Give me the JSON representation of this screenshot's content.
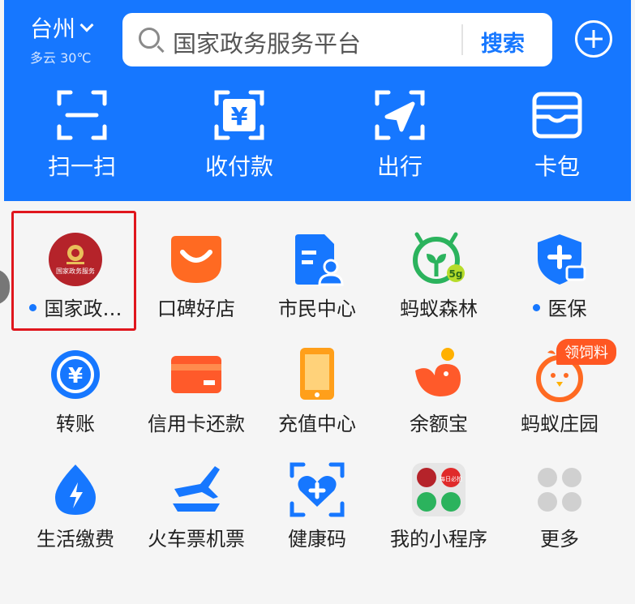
{
  "header": {
    "city": "台州",
    "weather": "多云 30℃",
    "search_placeholder": "国家政务服务平台",
    "search_button": "搜索"
  },
  "quick_actions": [
    {
      "label": "扫一扫",
      "icon": "scan-icon"
    },
    {
      "label": "收付款",
      "icon": "payment-icon"
    },
    {
      "label": "出行",
      "icon": "travel-icon"
    },
    {
      "label": "卡包",
      "icon": "wallet-icon"
    }
  ],
  "apps": [
    {
      "label": "国家政…",
      "icon": "gov-service-emblem-icon",
      "dot": true,
      "logo_text": "国家政务服务"
    },
    {
      "label": "口碑好店",
      "icon": "koubei-icon"
    },
    {
      "label": "市民中心",
      "icon": "citizen-center-icon"
    },
    {
      "label": "蚂蚁森林",
      "icon": "ant-forest-icon",
      "badge": "5g"
    },
    {
      "label": "医保",
      "icon": "medical-insurance-icon",
      "dot": true
    },
    {
      "label": "转账",
      "icon": "transfer-icon"
    },
    {
      "label": "信用卡还款",
      "icon": "credit-card-icon"
    },
    {
      "label": "充值中心",
      "icon": "recharge-icon"
    },
    {
      "label": "余额宝",
      "icon": "yuebao-icon"
    },
    {
      "label": "蚂蚁庄园",
      "icon": "ant-farm-icon",
      "badge": "领饲料"
    },
    {
      "label": "生活缴费",
      "icon": "utility-payment-icon"
    },
    {
      "label": "火车票机票",
      "icon": "tickets-icon"
    },
    {
      "label": "健康码",
      "icon": "health-code-icon"
    },
    {
      "label": "我的小程序",
      "icon": "mini-programs-icon",
      "logo_text": "每日必抢"
    },
    {
      "label": "更多",
      "icon": "more-icon"
    }
  ],
  "colors": {
    "primary": "#1677ff",
    "highlight_box": "#e0161d",
    "badge": "#ff5722"
  }
}
